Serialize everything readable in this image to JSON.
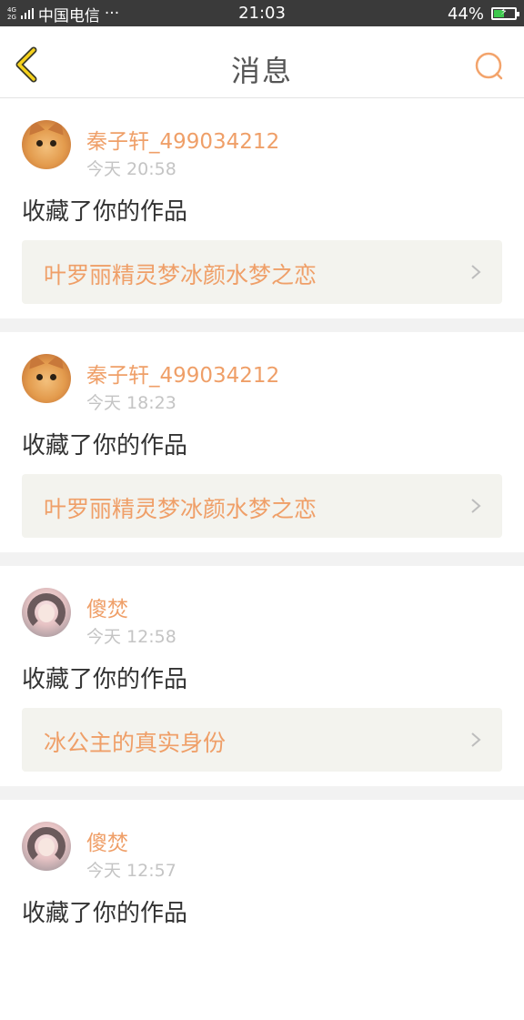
{
  "status_bar": {
    "network_type": [
      "4G",
      "2G"
    ],
    "carrier": "中国电信",
    "more": "···",
    "time": "21:03",
    "battery": "44%",
    "battery_level": 0.44
  },
  "nav": {
    "title": "消息",
    "back_icon": "chevron-left-icon",
    "search_icon": "search-icon",
    "accent": "#f3a46c"
  },
  "messages": [
    {
      "username": "秦子轩_499034212",
      "time": "今天 20:58",
      "action": "收藏了你的作品",
      "work_title": "叶罗丽精灵梦冰颜水梦之恋",
      "avatar": "cat"
    },
    {
      "username": "秦子轩_499034212",
      "time": "今天 18:23",
      "action": "收藏了你的作品",
      "work_title": "叶罗丽精灵梦冰颜水梦之恋",
      "avatar": "cat"
    },
    {
      "username": "傻焚",
      "time": "今天 12:58",
      "action": "收藏了你的作品",
      "work_title": "冰公主的真实身份",
      "avatar": "girl"
    },
    {
      "username": "傻焚",
      "time": "今天 12:57",
      "action": "收藏了你的作品",
      "work_title": "",
      "avatar": "girl"
    }
  ]
}
